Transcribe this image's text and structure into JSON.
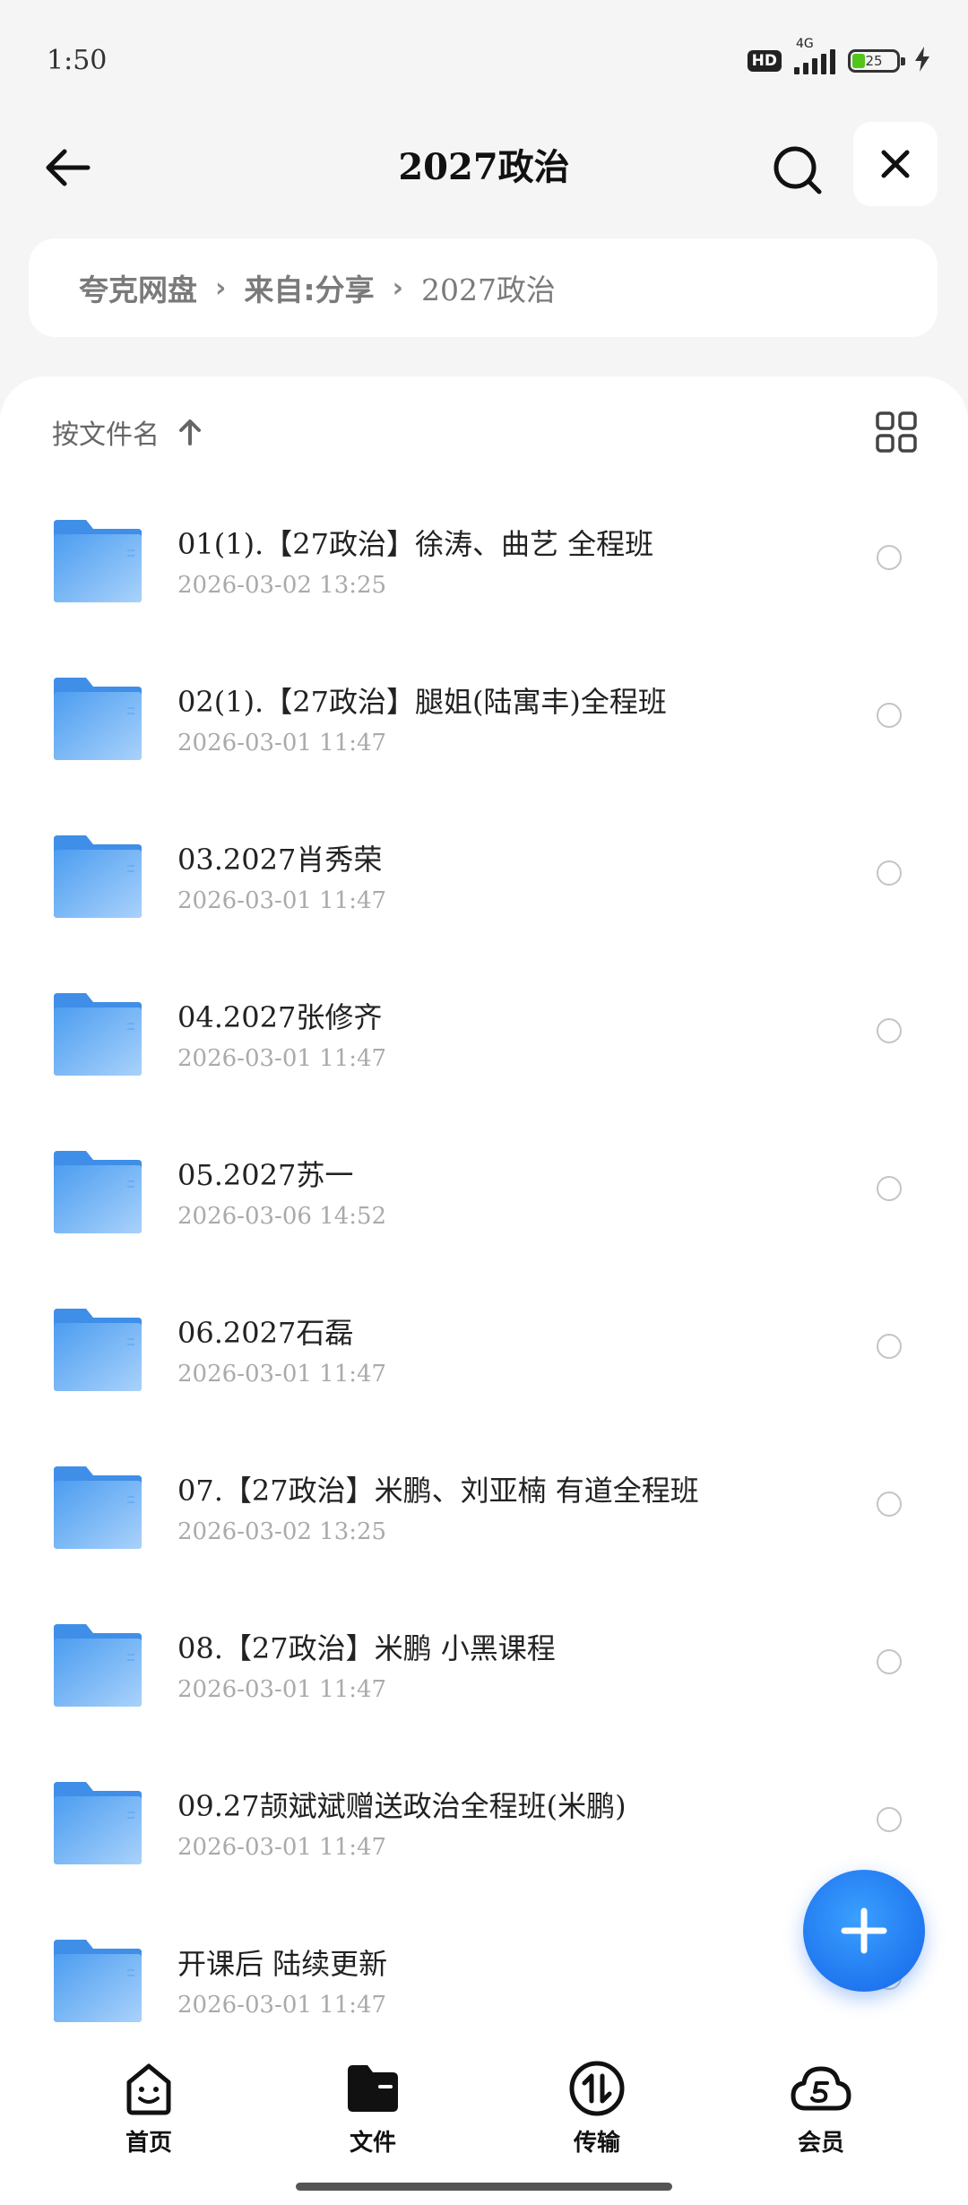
{
  "status_bar": {
    "time": "1:50",
    "hd_label": "HD",
    "network": "4G",
    "battery": "25"
  },
  "header": {
    "title": "2027政治",
    "back_icon": "arrow-left-icon",
    "search_icon": "search-icon",
    "close_icon": "close-icon"
  },
  "breadcrumb": [
    "夸克网盘",
    "来自:分享",
    "2027政治"
  ],
  "sort": {
    "label": "按文件名",
    "direction_icon": "arrow-up-icon",
    "view_icon": "grid-view-icon"
  },
  "files": [
    {
      "name": "01(1).【27政治】徐涛、曲艺 全程班",
      "date": "2026-03-02 13:25"
    },
    {
      "name": "02(1).【27政治】腿姐(陆寓丰)全程班",
      "date": "2026-03-01 11:47"
    },
    {
      "name": "03.2027肖秀荣",
      "date": "2026-03-01 11:47"
    },
    {
      "name": "04.2027张修齐",
      "date": "2026-03-01 11:47"
    },
    {
      "name": "05.2027苏一",
      "date": "2026-03-06 14:52"
    },
    {
      "name": "06.2027石磊",
      "date": "2026-03-01 11:47"
    },
    {
      "name": "07.【27政治】米鹏、刘亚楠 有道全程班",
      "date": "2026-03-02 13:25"
    },
    {
      "name": "08.【27政治】米鹏 小黑课程",
      "date": "2026-03-01 11:47"
    },
    {
      "name": "09.27颉斌斌赠送政治全程班(米鹏)",
      "date": "2026-03-01 11:47"
    },
    {
      "name": "开课后 陆续更新",
      "date": "2026-03-01 11:47"
    }
  ],
  "fab_icon": "plus-icon",
  "nav": [
    {
      "label": "首页",
      "icon": "home-face-icon"
    },
    {
      "label": "文件",
      "icon": "files-icon"
    },
    {
      "label": "传输",
      "icon": "transfer-icon"
    },
    {
      "label": "会员",
      "icon": "vip-cloud-icon"
    }
  ],
  "colors": {
    "folder": "#6aaef5",
    "fab": "#1e7ef0",
    "background": "#f5f5f5"
  }
}
